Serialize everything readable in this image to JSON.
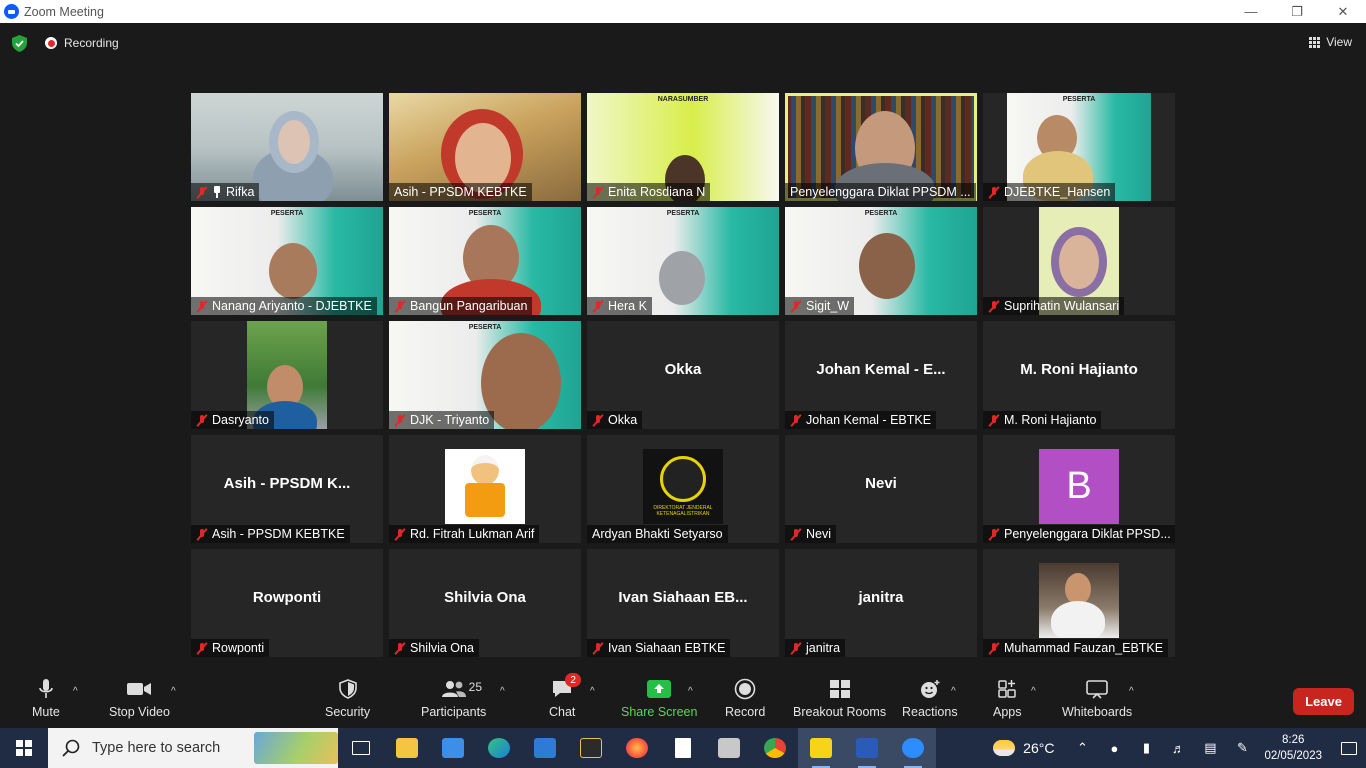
{
  "window": {
    "title": "Zoom Meeting"
  },
  "topbar": {
    "recording_label": "Recording",
    "view_label": "View"
  },
  "tiles": [
    {
      "name": "Rifka",
      "pinned": true
    },
    {
      "name": "Asih - PPSDM KEBTKE"
    },
    {
      "name": "Enita Rosdiana N"
    },
    {
      "name": "Penyelenggara Diklat PPSDM ...",
      "active": true
    },
    {
      "name": "DJEBTKE_Hansen"
    },
    {
      "name": "Nanang Ariyanto - DJEBTKE"
    },
    {
      "name": "Bangun Pangaribuan"
    },
    {
      "name": "Hera K"
    },
    {
      "name": "Sigit_W"
    },
    {
      "name": "Suprihatin Wulansari"
    },
    {
      "name": "Dasryanto"
    },
    {
      "name": "DJK - Triyanto"
    },
    {
      "name": "Okka",
      "bigname": "Okka"
    },
    {
      "name": "Johan Kemal - EBTKE",
      "bigname": "Johan Kemal - E..."
    },
    {
      "name": "M. Roni Hajianto",
      "bigname": "M. Roni Hajianto"
    },
    {
      "name": "Asih - PPSDM KEBTKE",
      "bigname": "Asih - PPSDM K..."
    },
    {
      "name": "Rd. Fitrah Lukman Arif"
    },
    {
      "name": "Ardyan Bhakti Setyarso",
      "mic": true
    },
    {
      "name": "Nevi",
      "bigname": "Nevi"
    },
    {
      "name": "Penyelenggara Diklat PPSD...",
      "avatar": "B"
    },
    {
      "name": "Rowponti",
      "bigname": "Rowponti"
    },
    {
      "name": "Shilvia Ona",
      "bigname": "Shilvia Ona"
    },
    {
      "name": "Ivan Siahaan EBTKE",
      "bigname": "Ivan Siahaan EB..."
    },
    {
      "name": "janitra",
      "bigname": "janitra"
    },
    {
      "name": "Muhammad Fauzan_EBTKE"
    }
  ],
  "slides": {
    "narasumber": "NARASUMBER",
    "peserta": "PESERTA",
    "logo_text": "DIREKTORAT JENDERAL KETENAGALISTRIKAN"
  },
  "toolbar": {
    "mute": "Mute",
    "stop_video": "Stop Video",
    "security": "Security",
    "participants": "Participants",
    "participants_count": "25",
    "chat": "Chat",
    "chat_badge": "2",
    "share_screen": "Share Screen",
    "record": "Record",
    "breakout_rooms": "Breakout Rooms",
    "reactions": "Reactions",
    "apps": "Apps",
    "whiteboards": "Whiteboards",
    "leave": "Leave"
  },
  "taskbar": {
    "search_placeholder": "Type here to search",
    "temperature": "26°C",
    "time": "8:26",
    "date": "02/05/2023"
  },
  "colors": {
    "accent_green": "#5fd35f",
    "leave_red": "#c7251e",
    "active_speaker": "#e8f27a"
  }
}
